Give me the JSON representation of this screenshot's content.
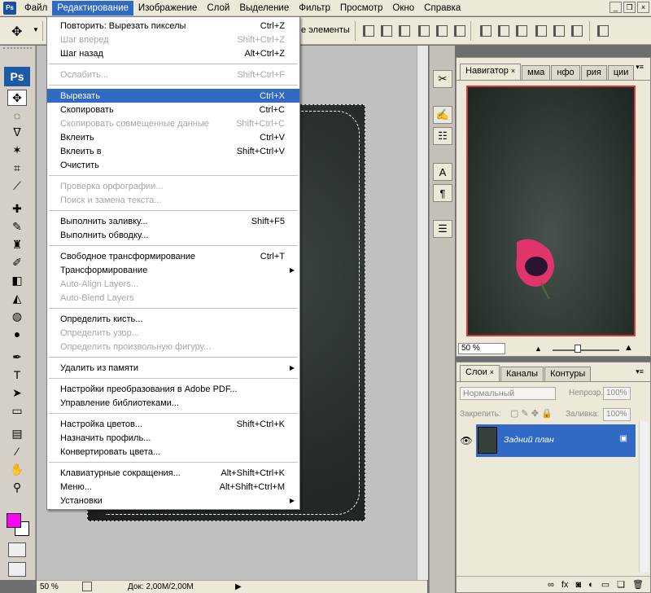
{
  "app_icon": "Ps",
  "menubar": {
    "items": [
      "Файл",
      "Редактирование",
      "Изображение",
      "Слой",
      "Выделение",
      "Фильтр",
      "Просмотр",
      "Окно",
      "Справка"
    ],
    "active_index": 1
  },
  "options_bar": {
    "partial_text": "е элементы"
  },
  "toolbox": {
    "logo": "Ps",
    "foreground_color": "#ff00ff",
    "background_color": "#ffffff"
  },
  "edit_menu": {
    "items": [
      {
        "label": "Повторить: Вырезать пикселы",
        "shortcut": "Ctrl+Z",
        "disabled": false
      },
      {
        "label": "Шаг вперед",
        "shortcut": "Shift+Ctrl+Z",
        "disabled": true
      },
      {
        "label": "Шаг назад",
        "shortcut": "Alt+Ctrl+Z",
        "disabled": false
      },
      {
        "separator": true
      },
      {
        "label": "Ослабить...",
        "shortcut": "Shift+Ctrl+F",
        "disabled": true
      },
      {
        "separator": true
      },
      {
        "label": "Вырезать",
        "shortcut": "Ctrl+X",
        "disabled": false,
        "highlighted": true
      },
      {
        "label": "Скопировать",
        "shortcut": "Ctrl+C",
        "disabled": false
      },
      {
        "label": "Скопировать совмещенные данные",
        "shortcut": "Shift+Ctrl+C",
        "disabled": true
      },
      {
        "label": "Вклеить",
        "shortcut": "Ctrl+V",
        "disabled": false
      },
      {
        "label": "Вклеить в",
        "shortcut": "Shift+Ctrl+V",
        "disabled": false
      },
      {
        "label": "Очистить",
        "shortcut": "",
        "disabled": false
      },
      {
        "separator": true
      },
      {
        "label": "Проверка орфографии...",
        "shortcut": "",
        "disabled": true
      },
      {
        "label": "Поиск и замена текста...",
        "shortcut": "",
        "disabled": true
      },
      {
        "separator": true
      },
      {
        "label": "Выполнить заливку...",
        "shortcut": "Shift+F5",
        "disabled": false
      },
      {
        "label": "Выполнить обводку...",
        "shortcut": "",
        "disabled": false
      },
      {
        "separator": true
      },
      {
        "label": "Свободное трансформирование",
        "shortcut": "Ctrl+T",
        "disabled": false
      },
      {
        "label": "Трансформирование",
        "shortcut": "",
        "disabled": false,
        "submenu": true
      },
      {
        "label": "Auto-Align Layers...",
        "shortcut": "",
        "disabled": true
      },
      {
        "label": "Auto-Blend Layers",
        "shortcut": "",
        "disabled": true
      },
      {
        "separator": true
      },
      {
        "label": "Определить кисть...",
        "shortcut": "",
        "disabled": false
      },
      {
        "label": "Определить узор...",
        "shortcut": "",
        "disabled": true
      },
      {
        "label": "Определить произвольную фигуру...",
        "shortcut": "",
        "disabled": true
      },
      {
        "separator": true
      },
      {
        "label": "Удалить из памяти",
        "shortcut": "",
        "disabled": false,
        "submenu": true
      },
      {
        "separator": true
      },
      {
        "label": "Настройки преобразования в Adobe PDF...",
        "shortcut": "",
        "disabled": false
      },
      {
        "label": "Управление библиотеками...",
        "shortcut": "",
        "disabled": false
      },
      {
        "separator": true
      },
      {
        "label": "Настройка цветов...",
        "shortcut": "Shift+Ctrl+K",
        "disabled": false
      },
      {
        "label": "Назначить профиль...",
        "shortcut": "",
        "disabled": false
      },
      {
        "label": "Конвертировать цвета...",
        "shortcut": "",
        "disabled": false
      },
      {
        "separator": true
      },
      {
        "label": "Клавиатурные сокращения...",
        "shortcut": "Alt+Shift+Ctrl+K",
        "disabled": false
      },
      {
        "label": "Меню...",
        "shortcut": "Alt+Shift+Ctrl+M",
        "disabled": false
      },
      {
        "label": "Установки",
        "shortcut": "",
        "disabled": false,
        "submenu": true
      }
    ]
  },
  "statusbar": {
    "zoom": "50 %",
    "doc_info": "Док: 2,00M/2,00M"
  },
  "navigator": {
    "tabs": [
      {
        "label": "Навигатор",
        "close": "×",
        "active": true
      },
      {
        "label": "мма"
      },
      {
        "label": "нфо"
      },
      {
        "label": "рия"
      },
      {
        "label": "ции"
      }
    ],
    "zoom": "50 %"
  },
  "layers": {
    "tabs": [
      {
        "label": "Слои",
        "close": "×",
        "active": true
      },
      {
        "label": "Каналы"
      },
      {
        "label": "Контуры"
      }
    ],
    "blend_mode": "Нормальный",
    "opacity_label": "Непрозр.:",
    "opacity_value": "100%",
    "lock_label": "Закрепить:",
    "fill_label": "Заливка:",
    "fill_value": "100%",
    "layer_name": "Задний план"
  }
}
